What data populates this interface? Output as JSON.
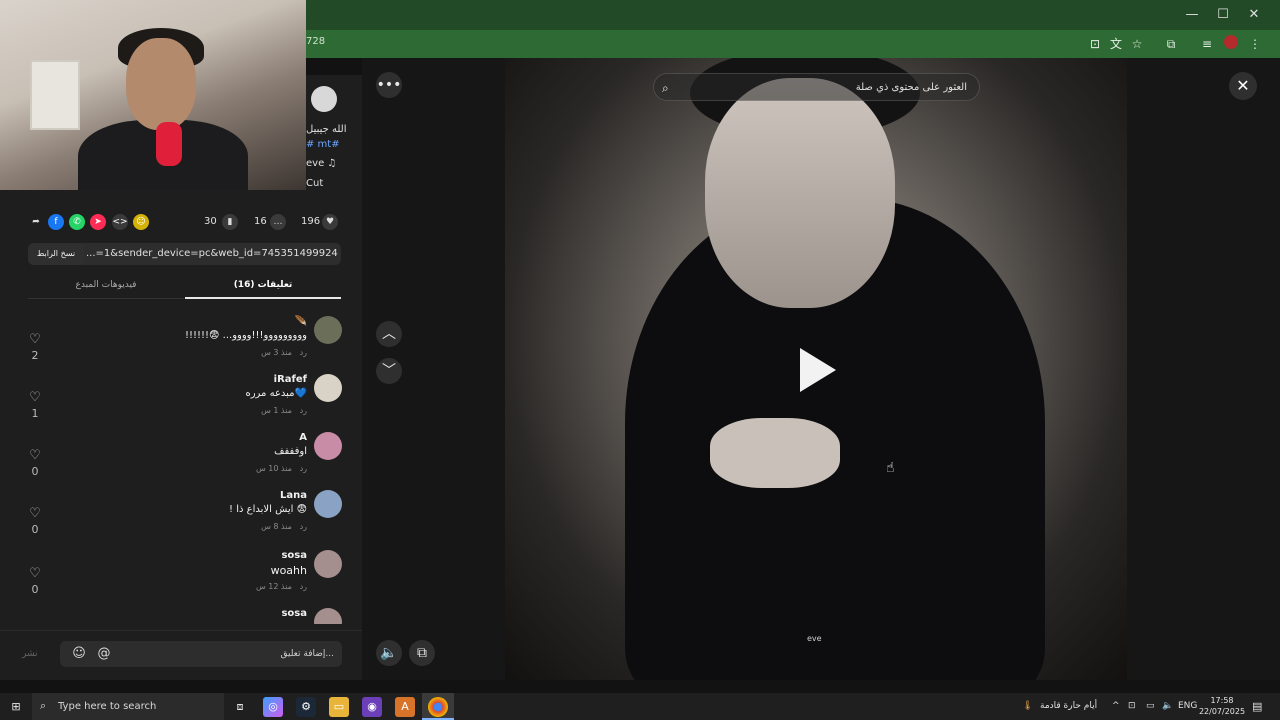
{
  "browser": {
    "url_fragment": "728",
    "window_controls": {
      "minimize": "—",
      "maximize": "☐",
      "close": "✕"
    }
  },
  "post": {
    "caption_fragment": "والله جيبيل",
    "hashtag_fragment": "# mt#",
    "sound_fragment": "eve ♫",
    "capcut_fragment": "Cut"
  },
  "stats": {
    "likes": "196",
    "comments": "16",
    "saves": "30"
  },
  "share_link": {
    "url": "...=1&sender_device=pc&web_id=7453514999245784581",
    "copy_label": "نسخ الرابط"
  },
  "tabs": {
    "comments_label": "(16) تعليقات",
    "creator_videos_label": "فيديوهات المبدع"
  },
  "comments": [
    {
      "name": "🪶",
      "text": "!!!!!!😨 ...ووووووووو!!!وووو",
      "time": "منذ 3 س",
      "reply": "رد",
      "likes": "2",
      "avatar_color": "#6b6f5a"
    },
    {
      "name": "iRafef",
      "text": "مبدعه مرره💙",
      "time": "منذ 1 س",
      "reply": "رد",
      "likes": "1",
      "avatar_color": "#d9d3c7"
    },
    {
      "name": "A",
      "text": "اوفففف",
      "time": "منذ 10 س",
      "reply": "رد",
      "likes": "0",
      "avatar_color": "#c98ca6"
    },
    {
      "name": "Lana",
      "text": "! ايش الابداع ذا 😨",
      "time": "منذ 8 س",
      "reply": "رد",
      "likes": "0",
      "avatar_color": "#8aa3c4"
    },
    {
      "name": "sosa",
      "text": "woahh",
      "time": "منذ 12 س",
      "reply": "رد",
      "likes": "0",
      "avatar_color": "#a58e8e"
    },
    {
      "name": "sosa",
      "text": "",
      "time": "",
      "reply": "",
      "likes": "",
      "avatar_color": "#a58e8e"
    }
  ],
  "comment_input": {
    "placeholder": "إضافة تعليق...",
    "post_label": "نشر"
  },
  "video": {
    "search_placeholder": "العثور على محتوى ذي صلة",
    "watermark": "eve"
  },
  "taskbar": {
    "search_placeholder": "Type here to search",
    "weather": "أيام حارة قادمة",
    "language": "ENG",
    "time": "17:58",
    "date": "22/07/2025"
  },
  "colors": {
    "titlebar": "#234a26",
    "addressbar": "#2e6b34",
    "panel": "#1e1e1e",
    "link_blue": "#6aa3ff",
    "mic_red": "#e0203a"
  }
}
